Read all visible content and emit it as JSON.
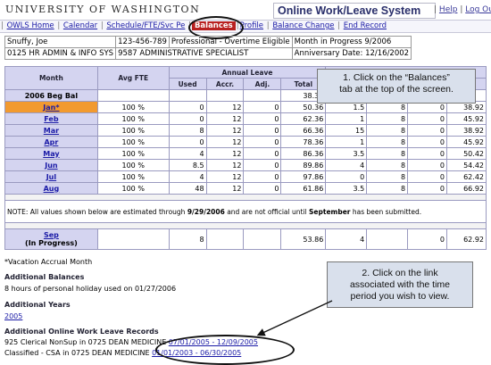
{
  "header": {
    "university": "UNIVERSITY OF WASHINGTON",
    "system_title": "Online Work/Leave System",
    "help": "Help",
    "logout": "Log Out",
    "separator": "|"
  },
  "nav": {
    "items": [
      "OWLS Home",
      "Calendar",
      "Schedule/FTE/Svc Pe",
      "Balances",
      "Profile",
      "Balance Change",
      "End Record"
    ]
  },
  "employee": {
    "name": "Snuffy, Joe",
    "id": "123-456-789",
    "type": "Professional - Overtime Eligible",
    "progress": "Month in Progress 9/2006",
    "dept": "0125 HR ADMIN & INFO SYS",
    "position": "9587 ADMINISTRATIVE SPECIALIST",
    "anniversary": "Anniversary Date: 12/16/2002"
  },
  "grid": {
    "annual_header": "Annual Leave",
    "col_month": "Month",
    "col_fte": "Avg FTE",
    "col_used": "Used",
    "col_accr": "Accr.",
    "col_adj": "Adj.",
    "col_total": "Total",
    "beg_label": "2006 Beg Bal",
    "beg_total": "38.36",
    "rows": [
      {
        "m": "Jan*",
        "fte": "100 %",
        "used": "0",
        "accr": "12",
        "adj": "0",
        "total": "50.36",
        "c1": "1.5",
        "c2": "8",
        "c3": "0",
        "c4": "38.92"
      },
      {
        "m": "Feb",
        "fte": "100 %",
        "used": "0",
        "accr": "12",
        "adj": "0",
        "total": "62.36",
        "c1": "1",
        "c2": "8",
        "c3": "0",
        "c4": "45.92"
      },
      {
        "m": "Mar",
        "fte": "100 %",
        "used": "8",
        "accr": "12",
        "adj": "0",
        "total": "66.36",
        "c1": "15",
        "c2": "8",
        "c3": "0",
        "c4": "38.92"
      },
      {
        "m": "Apr",
        "fte": "100 %",
        "used": "0",
        "accr": "12",
        "adj": "0",
        "total": "78.36",
        "c1": "1",
        "c2": "8",
        "c3": "0",
        "c4": "45.92"
      },
      {
        "m": "May",
        "fte": "100 %",
        "used": "4",
        "accr": "12",
        "adj": "0",
        "total": "86.36",
        "c1": "3.5",
        "c2": "8",
        "c3": "0",
        "c4": "50.42"
      },
      {
        "m": "Jun",
        "fte": "100 %",
        "used": "8.5",
        "accr": "12",
        "adj": "0",
        "total": "89.86",
        "c1": "4",
        "c2": "8",
        "c3": "0",
        "c4": "54.42"
      },
      {
        "m": "Jul",
        "fte": "100 %",
        "used": "4",
        "accr": "12",
        "adj": "0",
        "total": "97.86",
        "c1": "0",
        "c2": "8",
        "c3": "0",
        "c4": "62.42"
      },
      {
        "m": "Aug",
        "fte": "100 %",
        "used": "48",
        "accr": "12",
        "adj": "0",
        "total": "61.86",
        "c1": "3.5",
        "c2": "8",
        "c3": "0",
        "c4": "66.92"
      }
    ],
    "note_a": "NOTE: All values shown below are estimated through ",
    "note_date": "9/29/2006",
    "note_b": " and are not official until ",
    "note_month": "September",
    "note_c": " has been submitted.",
    "sep_row": {
      "m": "Sep",
      "m2": "(In Progress)",
      "used": "8",
      "total": "53.86",
      "c1": "4",
      "c2": "0",
      "c4": "62.92"
    }
  },
  "footer": {
    "vacation_note": "*Vacation Accrual Month",
    "balances_title": "Additional Balances",
    "balances_text_a": "8 hours of personal holiday used on ",
    "balances_date": "01/27/2006",
    "years_title": "Additional Years",
    "year_link": "2005",
    "records_title": "Additional Online Work Leave Records",
    "rec1_text": "925 Clerical NonSup in 0725 DEAN MEDICINE ",
    "rec1_link": "07/01/2005 - 12/09/2005",
    "rec2_text": "Classified - CSA in 0725 DEAN MEDICINE ",
    "rec2_link": "01/01/2003 - 06/30/2005"
  },
  "callouts": {
    "c1_line1": "1.  Click on the “Balances”",
    "c1_line2": "tab at the top of the screen.",
    "c2_line1": "2. Click on the link",
    "c2_line2": "associated with the time",
    "c2_line3": "period you wish to view."
  }
}
